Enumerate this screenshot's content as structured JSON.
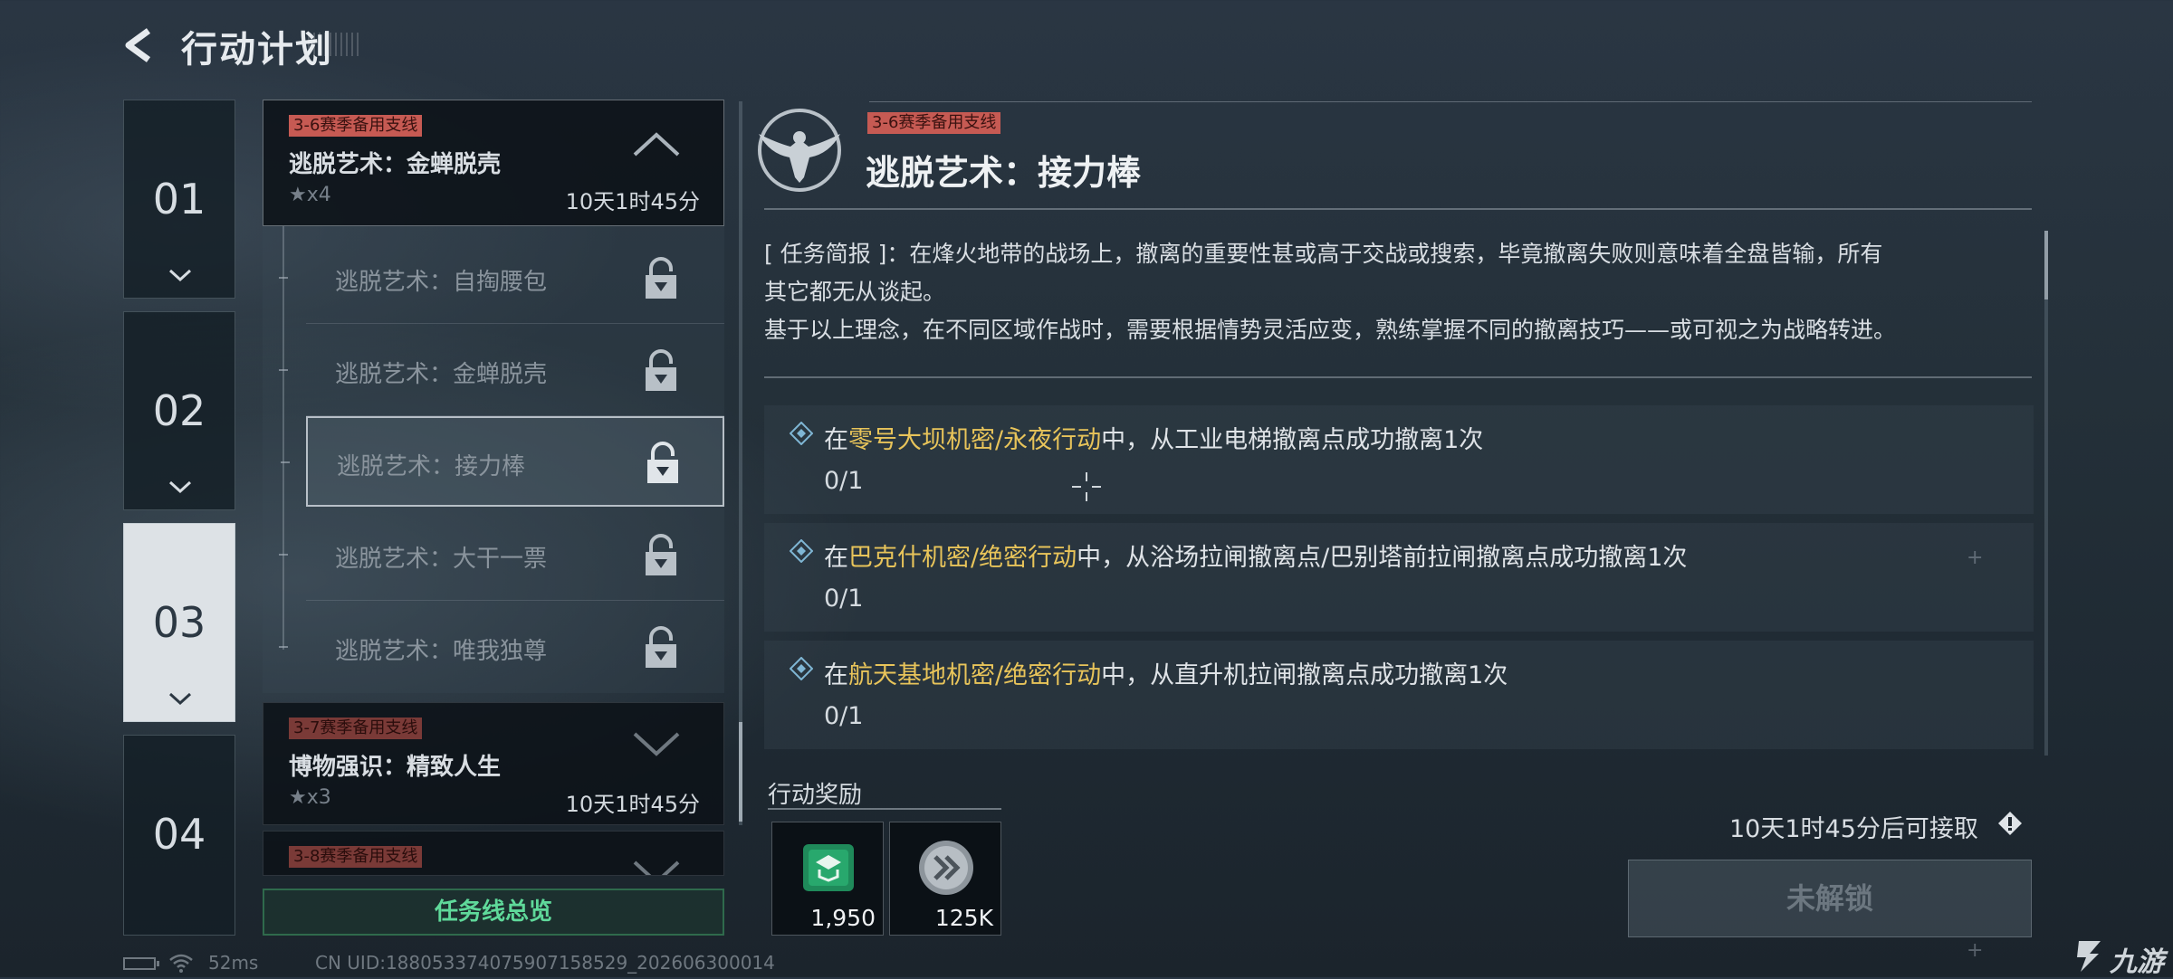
{
  "header": {
    "title": "行动计划"
  },
  "chapters": [
    {
      "num": "01",
      "active": false
    },
    {
      "num": "02",
      "active": false
    },
    {
      "num": "03",
      "active": true
    },
    {
      "num": "04",
      "active": false
    }
  ],
  "missions": {
    "expanded": {
      "tag": "3-6赛季备用支线",
      "name": "逃脱艺术：金蝉脱壳",
      "stars": "★x4",
      "time": "10天1时45分",
      "subs": [
        {
          "name": "逃脱艺术：自掏腰包"
        },
        {
          "name": "逃脱艺术：金蝉脱壳"
        },
        {
          "name": "逃脱艺术：接力棒"
        },
        {
          "name": "逃脱艺术：大干一票"
        },
        {
          "name": "逃脱艺术：唯我独尊"
        }
      ]
    },
    "second": {
      "tag": "3-7赛季备用支线",
      "name": "博物强识：精致人生",
      "stars": "★x3",
      "time": "10天1时45分"
    },
    "third": {
      "tag": "3-8赛季备用支线"
    },
    "overview_button": "任务线总览"
  },
  "detail": {
    "tag": "3-6赛季备用支线",
    "title": "逃脱艺术：接力棒",
    "brief_line1": "[ 任务简报 ]：在烽火地带的战场上，撤离的重要性甚或高于交战或搜索，毕竟撤离失败则意味着全盘皆输，所有",
    "brief_line2": "其它都无从谈起。",
    "brief_line3": "基于以上理念，在不同区域作战时，需要根据情势灵活应变，熟练掌握不同的撤离技巧——或可视之为战略转进。",
    "objectives": [
      {
        "pre": "在",
        "hl": "零号大坝机密/永夜行动",
        "post": "中，从工业电梯撤离点成功撤离1次",
        "progress": "0/1"
      },
      {
        "pre": "在",
        "hl": "巴克什机密/绝密行动",
        "post": "中，从浴场拉闸撤离点/巴别塔前拉闸撤离点成功撤离1次",
        "progress": "0/1"
      },
      {
        "pre": "在",
        "hl": "航天基地机密/绝密行动",
        "post": "中，从直升机拉闸撤离点成功撤离1次",
        "progress": "0/1"
      }
    ],
    "reward_label": "行动奖励",
    "rewards": [
      {
        "icon": "green-badge-icon",
        "count": "1,950"
      },
      {
        "icon": "silver-coin-icon",
        "count": "125K"
      }
    ],
    "unlock_time": "10天1时45分后可接取",
    "locked_button": "未解锁"
  },
  "status": {
    "ping": "52ms",
    "uid": "CN UID:18805337407590715852​9_202606300014"
  },
  "watermark": "九游",
  "colors": {
    "highlight": "#e8c45a",
    "tag": "#c65a53",
    "overview": "#5fd99a"
  }
}
